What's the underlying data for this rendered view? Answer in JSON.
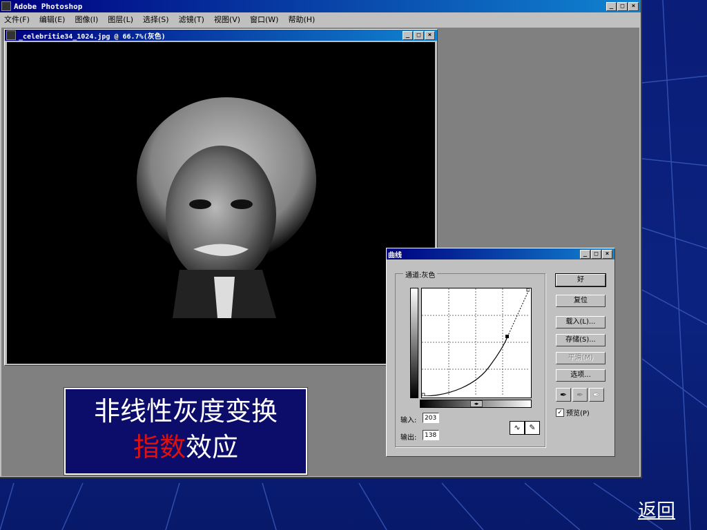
{
  "app": {
    "title": "Adobe Photoshop",
    "menu": [
      "文件(F)",
      "编辑(E)",
      "图像(I)",
      "图层(L)",
      "选择(S)",
      "滤镜(T)",
      "视图(V)",
      "窗口(W)",
      "帮助(H)"
    ]
  },
  "document": {
    "title": "_celebritie34_1024.jpg @ 66.7%(灰色)"
  },
  "curves": {
    "title": "曲线",
    "channel_label": "通道:灰色",
    "input_label": "输入:",
    "input_value": "203",
    "output_label": "输出:",
    "output_value": "138",
    "buttons": {
      "ok": "好",
      "reset": "复位",
      "load": "载入(L)...",
      "save": "存储(S)...",
      "smooth": "平滑(M)",
      "options": "选项..."
    },
    "preview_label": "预览(P)",
    "preview_checked": true
  },
  "caption": {
    "line1": "非线性灰度变换",
    "line2_red": "指数",
    "line2_white": "效应"
  },
  "nav": {
    "back": "返回"
  }
}
